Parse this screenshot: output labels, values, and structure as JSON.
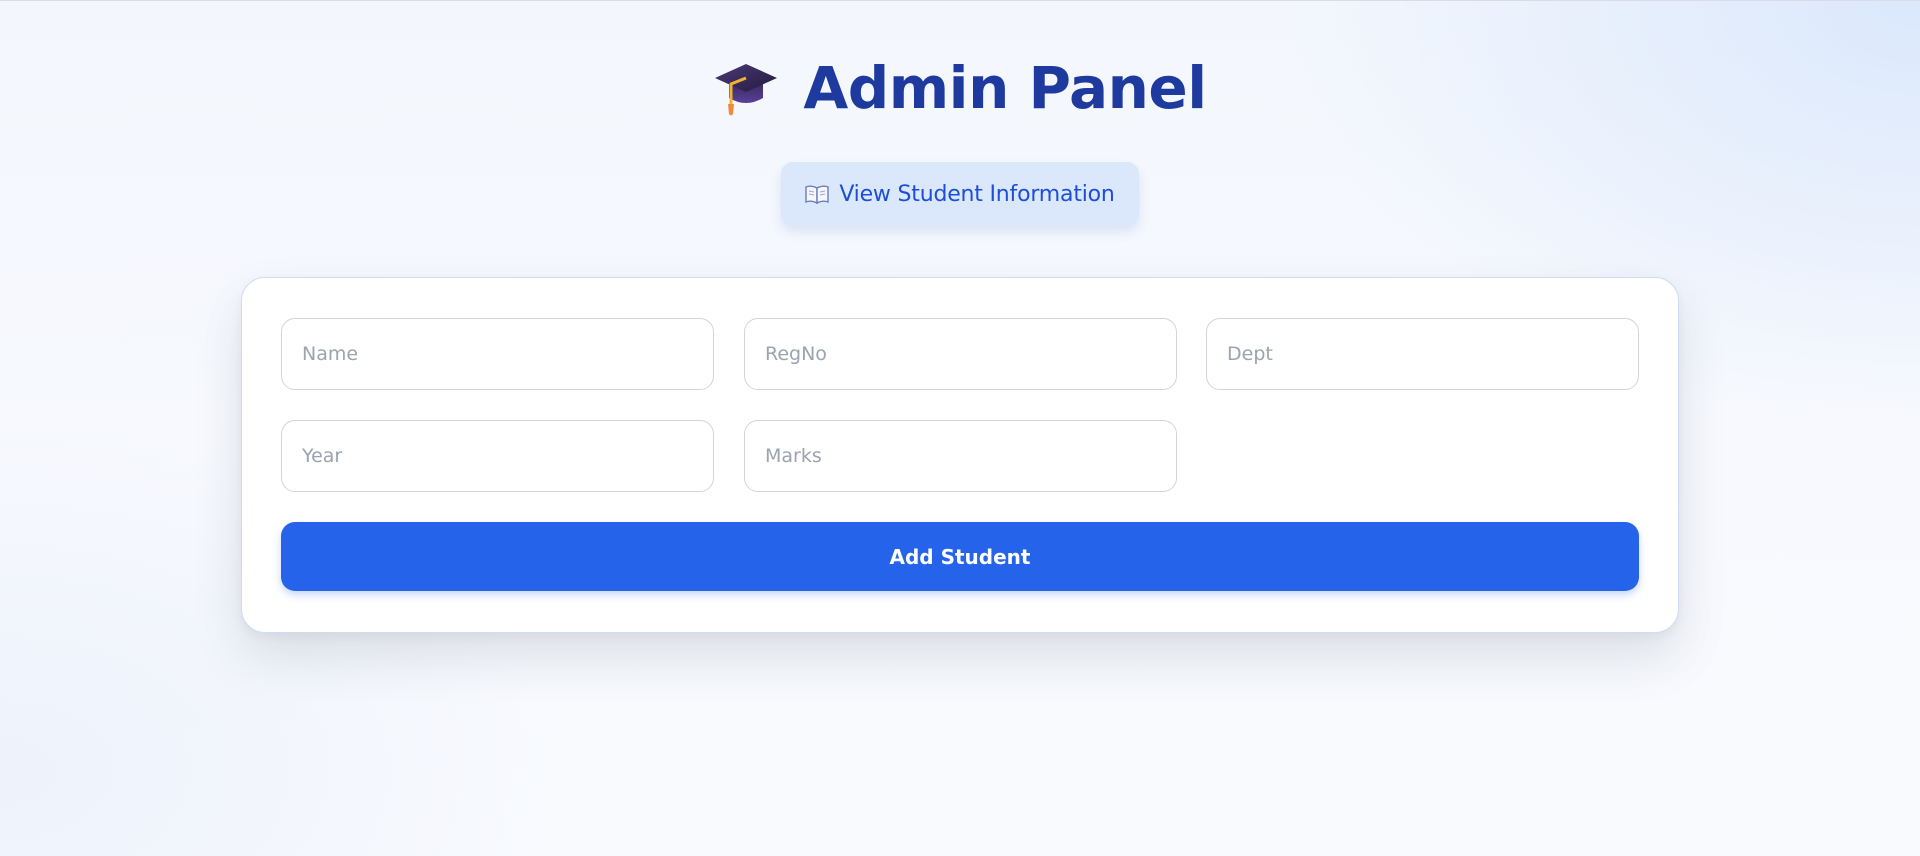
{
  "header": {
    "title": "Admin Panel",
    "icon": "graduation-cap-icon"
  },
  "view_button": {
    "label": "View Student Information",
    "icon": "open-book-icon"
  },
  "form": {
    "fields": {
      "name": {
        "placeholder": "Name",
        "value": ""
      },
      "regno": {
        "placeholder": "RegNo",
        "value": ""
      },
      "dept": {
        "placeholder": "Dept",
        "value": ""
      },
      "year": {
        "placeholder": "Year",
        "value": ""
      },
      "marks": {
        "placeholder": "Marks",
        "value": ""
      }
    },
    "submit_label": "Add Student"
  },
  "colors": {
    "title": "#1e3a9f",
    "accent": "#2563eb",
    "view_button_bg": "#dbe7fb",
    "view_button_text": "#1d4ed8"
  }
}
